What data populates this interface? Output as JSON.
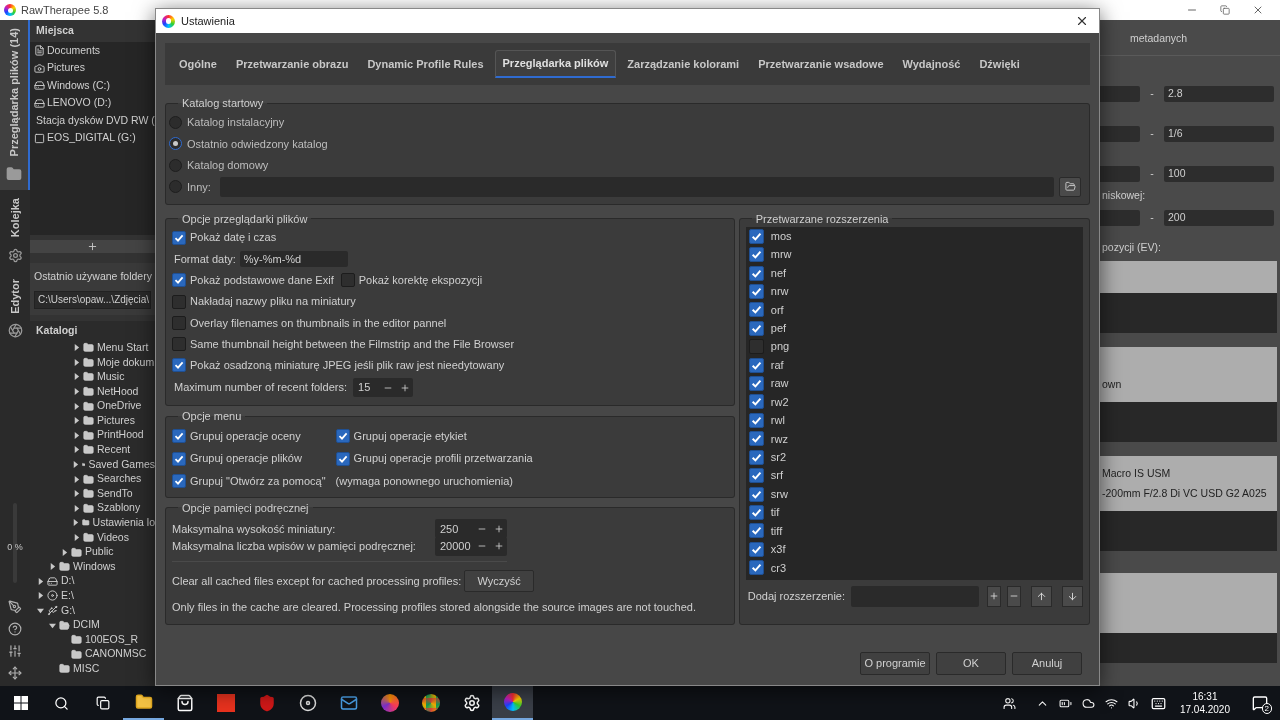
{
  "app": {
    "title": "RawTherapee 5.8"
  },
  "side_tabs": [
    {
      "label": "Przeglądarka plików (14)",
      "selected": true,
      "kind": "folder"
    },
    {
      "label": "Kolejka",
      "selected": false,
      "kind": "gears"
    },
    {
      "label": "Edytor",
      "selected": false,
      "kind": "aperture"
    }
  ],
  "zoom": {
    "reading": "0 %"
  },
  "places": {
    "title": "Miejsca",
    "items": [
      {
        "label": "Documents",
        "kind": "document"
      },
      {
        "label": "Pictures",
        "kind": "camera"
      },
      {
        "label": "Windows (C:)",
        "kind": "drive"
      },
      {
        "label": "LENOVO (D:)",
        "kind": "drive"
      },
      {
        "label": "Stacja dysków DVD RW (",
        "kind": "dvd"
      },
      {
        "label": "EOS_DIGITAL (G:)",
        "kind": "card"
      }
    ]
  },
  "recent": {
    "title": "Ostatnio używane foldery",
    "value": "C:\\Users\\opaw...\\Zdjęcia\\"
  },
  "catalogs": {
    "title": "Katalogi",
    "tree": [
      {
        "children": [
          {
            "children": [
              {
                "children": [
                  {
                    "label": "Menu Start",
                    "kind": "folder",
                    "expanded": false
                  },
                  {
                    "label": "Moje dokum",
                    "kind": "folder",
                    "expanded": false
                  },
                  {
                    "label": "Music",
                    "kind": "folder",
                    "expanded": false
                  },
                  {
                    "label": "NetHood",
                    "kind": "folder",
                    "expanded": false
                  },
                  {
                    "label": "OneDrive",
                    "kind": "folder",
                    "expanded": false
                  },
                  {
                    "label": "Pictures",
                    "kind": "folder",
                    "expanded": false
                  },
                  {
                    "label": "PrintHood",
                    "kind": "folder",
                    "expanded": false
                  },
                  {
                    "label": "Recent",
                    "kind": "folder",
                    "expanded": false
                  },
                  {
                    "label": "Saved Games",
                    "kind": "folder",
                    "expanded": false
                  },
                  {
                    "label": "Searches",
                    "kind": "folder",
                    "expanded": false
                  },
                  {
                    "label": "SendTo",
                    "kind": "folder",
                    "expanded": false
                  },
                  {
                    "label": "Szablony",
                    "kind": "folder",
                    "expanded": false
                  },
                  {
                    "label": "Ustawienia lo",
                    "kind": "folder",
                    "expanded": false
                  },
                  {
                    "label": "Videos",
                    "kind": "folder",
                    "expanded": false
                  }
                ]
              },
              {
                "label": "Public",
                "kind": "folder",
                "expanded": false
              }
            ]
          },
          {
            "label": "Windows",
            "kind": "folder",
            "expanded": false
          }
        ]
      },
      {
        "label": "D:\\",
        "kind": "drive",
        "expanded": false
      },
      {
        "label": "E:\\",
        "kind": "dvd",
        "expanded": false
      },
      {
        "label": "G:\\",
        "kind": "usb",
        "expanded": true,
        "children": [
          {
            "label": "DCIM",
            "kind": "folder",
            "expanded": true,
            "children": [
              {
                "label": "100EOS_R",
                "kind": "folder"
              },
              {
                "label": "CANONMSC",
                "kind": "folder"
              }
            ]
          },
          {
            "label": "MISC",
            "kind": "folder"
          }
        ]
      }
    ]
  },
  "right_panel": {
    "heading": "metadanych",
    "ranges": [
      {
        "separator": "-",
        "max": "2.8"
      },
      {
        "separator": "-",
        "max": "1/6"
      },
      {
        "separator": "-",
        "max": "100"
      },
      {
        "label": "niskowej:",
        "separator": "-",
        "max": "200"
      }
    ],
    "lists": [
      {
        "label": "pozycji (EV):"
      },
      {
        "rows": [
          "own"
        ]
      },
      {
        "rows": [
          "Macro IS USM",
          "-200mm F/2.8 Di VC USD G2 A025"
        ]
      }
    ]
  },
  "dialog": {
    "title": "Ustawienia",
    "tabs": [
      {
        "label": "Ogólne",
        "selected": false
      },
      {
        "label": "Przetwarzanie obrazu",
        "selected": false
      },
      {
        "label": "Dynamic Profile Rules",
        "selected": false
      },
      {
        "label": "Przeglądarka plików",
        "selected": true
      },
      {
        "label": "Zarządzanie kolorami",
        "selected": false
      },
      {
        "label": "Przetwarzanie wsadowe",
        "selected": false
      },
      {
        "label": "Wydajność",
        "selected": false
      },
      {
        "label": "Dźwięki",
        "selected": false
      }
    ],
    "startup": {
      "title": "Katalog startowy",
      "options": [
        {
          "label": "Katalog instalacyjny",
          "selected": false
        },
        {
          "label": "Ostatnio odwiedzony katalog",
          "selected": true
        },
        {
          "label": "Katalog domowy",
          "selected": false
        },
        {
          "label": "Inny:",
          "selected": false,
          "kind": "path"
        }
      ]
    },
    "browser": {
      "title": "Opcje przeglądarki plików",
      "rows": [
        {
          "kind": "check",
          "label": "Pokaż datę i czas",
          "checked": true
        },
        {
          "kind": "text",
          "label": "Format daty:",
          "value": "%y-%m-%d"
        },
        {
          "kind": "checks",
          "items": [
            {
              "label": "Pokaż podstawowe dane Exif",
              "checked": true
            },
            {
              "label": "Pokaż korektę ekspozycji",
              "checked": false
            }
          ]
        },
        {
          "kind": "check",
          "label": "Nakładaj nazwy pliku na miniatury",
          "checked": false
        },
        {
          "kind": "check",
          "label": "Overlay filenames on thumbnails in the editor pannel",
          "checked": false
        },
        {
          "kind": "check",
          "label": "Same thumbnail height between the Filmstrip and the File Browser",
          "checked": false
        },
        {
          "kind": "check",
          "label": "Pokaż osadzoną miniaturę JPEG jeśli plik raw jest nieedytowany",
          "checked": true
        },
        {
          "kind": "spin",
          "label": "Maximum number of recent folders:",
          "value": "15"
        }
      ]
    },
    "menu": {
      "title": "Opcje menu",
      "items": [
        {
          "label": "Grupuj operacje oceny",
          "checked": true
        },
        {
          "label": "Grupuj operacje etykiet",
          "checked": true
        },
        {
          "label": "Grupuj operacje plików",
          "checked": true
        },
        {
          "label": "Grupuj operacje profili przetwarzania",
          "checked": true
        },
        {
          "label": "Grupuj \"Otwórz za pomocą\"",
          "checked": true
        }
      ],
      "note": "(wymaga ponownego uruchomienia)"
    },
    "cache": {
      "title": "Opcje pamięci podręcznej",
      "spins": [
        {
          "label": "Maksymalna wysokość miniatury:",
          "value": "250"
        },
        {
          "label": "Maksymalna liczba wpisów w pamięci podręcznej:",
          "value": "20000"
        }
      ],
      "clear_label": "Clear all cached files except for cached processing profiles:",
      "clear_button": "Wyczyść",
      "note": "Only files in the cache are cleared. Processing profiles stored alongside the source images are not touched."
    },
    "extensions": {
      "title": "Przetwarzane rozszerzenia",
      "items": [
        {
          "label": "mos",
          "checked": true
        },
        {
          "label": "mrw",
          "checked": true
        },
        {
          "label": "nef",
          "checked": true
        },
        {
          "label": "nrw",
          "checked": true
        },
        {
          "label": "orf",
          "checked": true
        },
        {
          "label": "pef",
          "checked": true
        },
        {
          "label": "png",
          "checked": false
        },
        {
          "label": "raf",
          "checked": true
        },
        {
          "label": "raw",
          "checked": true
        },
        {
          "label": "rw2",
          "checked": true
        },
        {
          "label": "rwl",
          "checked": true
        },
        {
          "label": "rwz",
          "checked": true
        },
        {
          "label": "sr2",
          "checked": true
        },
        {
          "label": "srf",
          "checked": true
        },
        {
          "label": "srw",
          "checked": true
        },
        {
          "label": "tif",
          "checked": true
        },
        {
          "label": "tiff",
          "checked": true
        },
        {
          "label": "x3f",
          "checked": true
        },
        {
          "label": "cr3",
          "checked": true
        }
      ],
      "add_label": "Dodaj rozszerzenie:"
    },
    "buttons": [
      "O programie",
      "OK",
      "Anuluj"
    ]
  },
  "taskbar": {
    "time": "16:31",
    "date": "17.04.2020",
    "notifications": "2"
  }
}
